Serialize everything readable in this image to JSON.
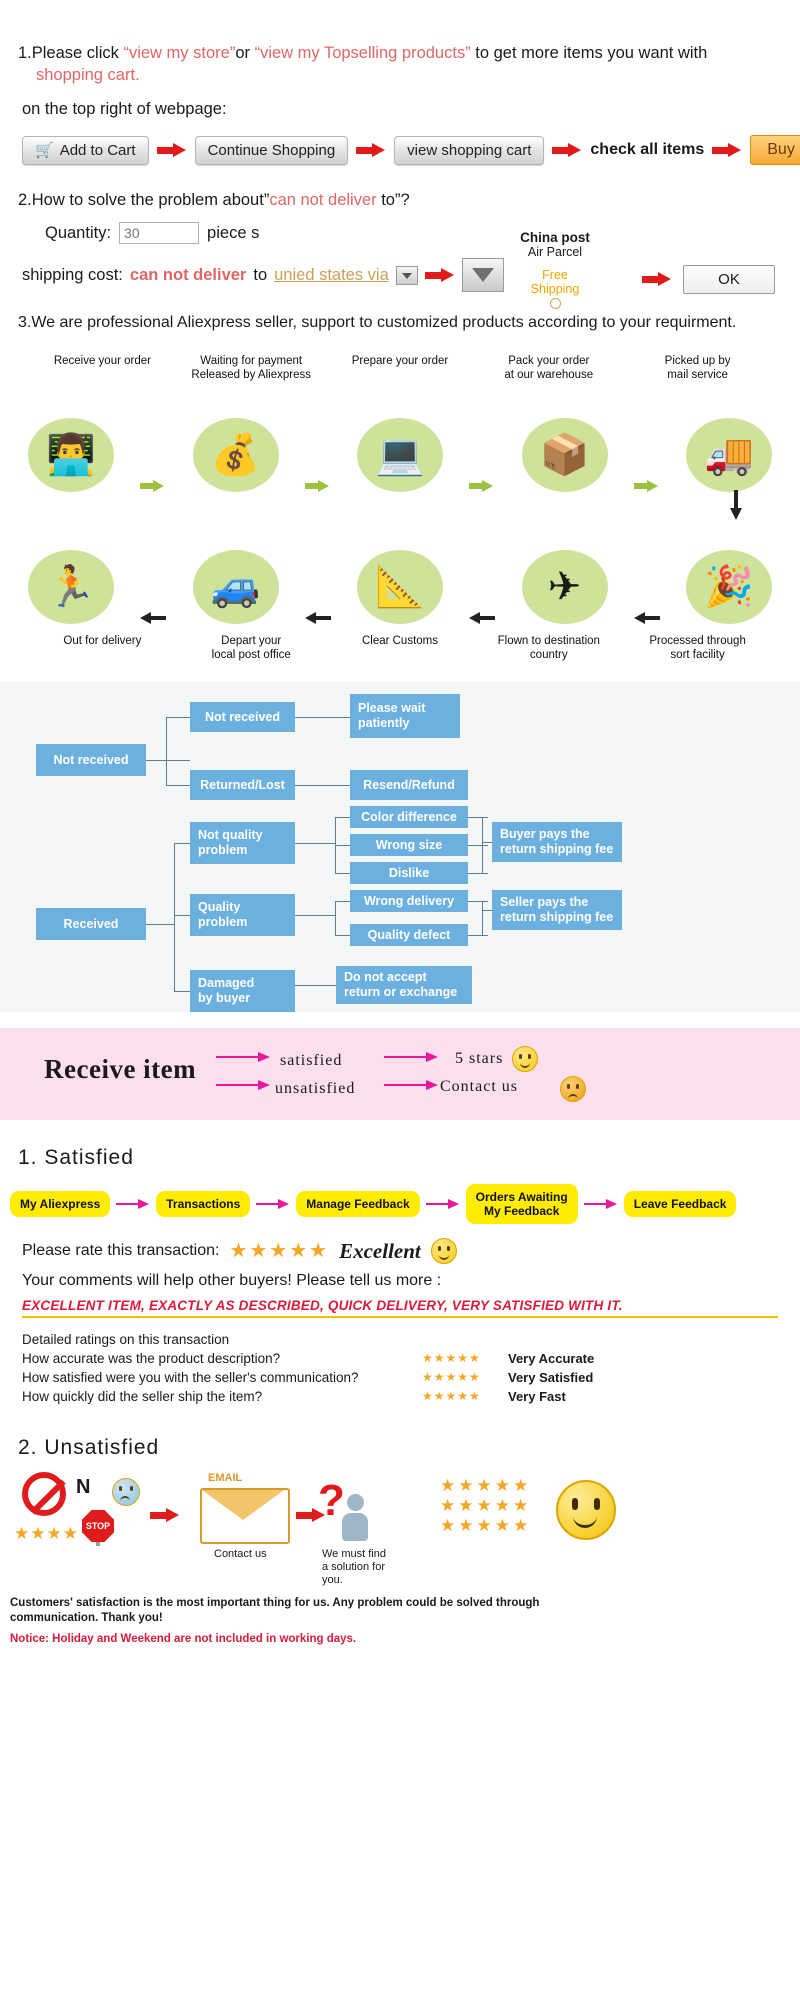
{
  "section1": {
    "number": "1.",
    "text_a": "Please click ",
    "link1": "“view my store”",
    "text_b": "or ",
    "link2": "“view my Topselling products”",
    "text_c": " to get more items you want with ",
    "link3": "shopping cart.",
    "subline": "on the top right of webpage:",
    "buttons": {
      "add_to_cart": "Add to Cart",
      "cart_icon": "shopping-cart-icon",
      "continue_shopping": "Continue Shopping",
      "view_shopping_cart": "view shopping cart",
      "check_all_items": "check all items",
      "buy_now": "Buy now"
    }
  },
  "section2": {
    "number": "2.",
    "heading_a": "How to solve the problem about”",
    "heading_red": "can not deliver",
    "heading_b": " to”?",
    "quantity_label": "Quantity:",
    "quantity_value": "30",
    "piece_label": "piece s",
    "shipping_label": "shipping cost:",
    "shipping_red": "can not deliver",
    "shipping_to": " to ",
    "country": "unied states via",
    "china_post_title": "China post",
    "china_post_sub": "Air Parcel",
    "free_shipping_1": "Free",
    "free_shipping_2": "Shipping",
    "ok_button": "OK"
  },
  "section3": {
    "text": "3.We are professional Aliexpress seller, support to customized products according to your requirment."
  },
  "delivery_flow": {
    "top_row": [
      {
        "caption": "Receive your order",
        "icon": "person-at-computer-icon",
        "emoji": "👩‍💻"
      },
      {
        "caption": "Waiting for payment\nReleased by Aliexpress",
        "icon": "money-bag-icon",
        "emoji": "💰"
      },
      {
        "caption": "Prepare your order",
        "icon": "computer-icon",
        "emoji": "🖥"
      },
      {
        "caption": "Pack your order\nat our warehouse",
        "icon": "worker-packing-icon",
        "emoji": "📦"
      },
      {
        "caption": "Picked up by\nmail service",
        "icon": "mail-truck-icon",
        "emoji": "🚐"
      }
    ],
    "bottom_row": [
      {
        "caption": "Out for delivery",
        "icon": "delivery-person-icon",
        "emoji": "🏃"
      },
      {
        "caption": "Depart your\nlocal post office",
        "icon": "van-icon",
        "emoji": "🚐"
      },
      {
        "caption": "Clear Customs",
        "icon": "customs-stamp-icon",
        "emoji": "📐"
      },
      {
        "caption": "Flown to destination\ncountry",
        "icon": "airplane-icon",
        "emoji": "✈"
      },
      {
        "caption": "Processed through\nsort facility",
        "icon": "sorting-facility-icon",
        "emoji": "🎉"
      }
    ]
  },
  "blue_flow": {
    "not_received_root": "Not received",
    "not_received_child": "Not received",
    "returned_lost": "Returned/Lost",
    "please_wait": "Please wait\npatiently",
    "resend_refund": "Resend/Refund",
    "received_root": "Received",
    "not_quality_problem": "Not quality\nproblem",
    "quality_problem": "Quality\nproblem",
    "damaged_by_buyer": "Damaged\nby buyer",
    "color_difference": "Color difference",
    "wrong_size": "Wrong size",
    "dislike": "Dislike",
    "wrong_delivery": "Wrong delivery",
    "quality_defect": "Quality defect",
    "buyer_pays": "Buyer pays the\nreturn shipping fee",
    "seller_pays": "Seller pays the\nreturn shipping fee",
    "do_not_accept": "Do not accept\nreturn or exchange",
    "box_color": "#6cb0e0",
    "bg_color": "#f4f6f7"
  },
  "pink_band": {
    "title": "Receive item",
    "row1_label": "satisfied",
    "row1_result": "5 stars",
    "row2_label": "unsatisfied",
    "row2_result": "Contact us",
    "bg_color": "#fbdfec",
    "arrow_color": "#e8189b"
  },
  "satisfied": {
    "heading": "1. Satisfied",
    "chips": [
      "My Aliexpress",
      "Transactions",
      "Manage Feedback",
      "Orders Awaiting\nMy Feedback",
      "Leave Feedback"
    ],
    "rate_label": "Please rate this transaction:",
    "stars": "★★★★★",
    "rating_word": "Excellent",
    "comments_label": "Your comments will help other buyers! Please tell us more :",
    "quote": "EXCELLENT ITEM, EXACTLY AS DESCRIBED, QUICK DELIVERY, VERY SATISFIED WITH IT.",
    "detailed_title": "Detailed ratings on this transaction",
    "detail_rows": [
      {
        "question": "How accurate was the product description?",
        "stars": "★★★★★",
        "value": "Very Accurate"
      },
      {
        "question": "How satisfied were you with the seller's communication?",
        "stars": "★★★★★",
        "value": "Very Satisfied"
      },
      {
        "question": "How quickly did the seller ship the item?",
        "stars": "★★★★★",
        "value": "Very Fast"
      }
    ]
  },
  "unsatisfied": {
    "heading": "2. Unsatisfied",
    "no_label": "N",
    "stop_label": "STOP",
    "bad_stars": "★★★★",
    "email_tag": "EMAIL",
    "contact_caption": "Contact us",
    "solution_caption": "We must find\na solution for\nyou.",
    "good_stars_rows": [
      "★★★★★",
      "★★★★★",
      "★★★★★"
    ]
  },
  "footer": {
    "line1": "Customers' satisfaction is the most important thing for us. Any problem could be solved through",
    "line2": "communication. Thank you!",
    "notice": "Notice: Holiday and Weekend are not included in working days."
  }
}
